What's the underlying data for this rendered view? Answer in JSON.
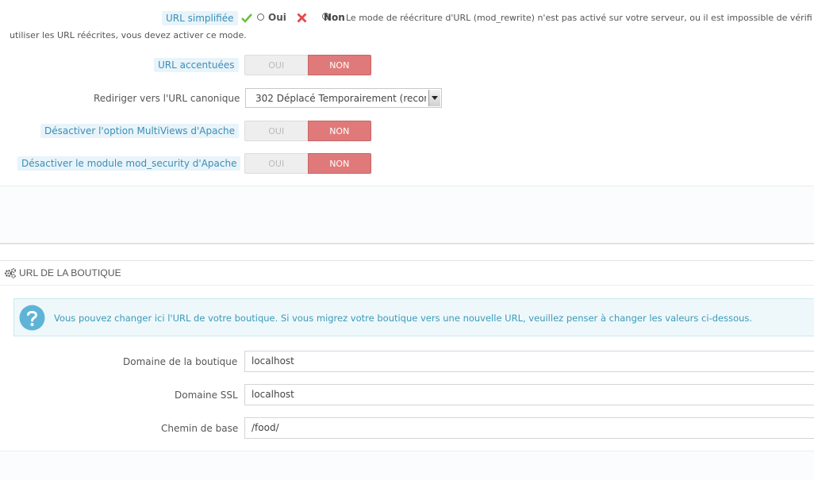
{
  "seo": {
    "simplified_url": {
      "label": "URL simplifiée",
      "oui": "Oui",
      "non": "Non",
      "note": "Le mode de réécriture d'URL (mod_rewrite) n'est pas activé sur votre serveur, ou il est impossible de vérifi",
      "note_line2": "utiliser les URL réécrites, vous devez activer ce mode."
    },
    "accented_url": {
      "label": "URL accentuées",
      "oui": "OUI",
      "non": "NON"
    },
    "canonical": {
      "label": "Rediriger vers l'URL canonique",
      "value": "302 Déplacé Temporairement (recom"
    },
    "multiviews": {
      "label": "Désactiver l'option MultiViews d'Apache",
      "oui": "OUI",
      "non": "NON"
    },
    "mod_security": {
      "label": "Désactiver le module mod_security d'Apache",
      "oui": "OUI",
      "non": "NON"
    }
  },
  "shop_url": {
    "section_title": "URL DE LA BOUTIQUE",
    "info": "Vous pouvez changer ici l'URL de votre boutique. Si vous migrez votre boutique vers une nouvelle URL, veuillez penser à changer les valeurs ci-dessous.",
    "domain": {
      "label": "Domaine de la boutique",
      "value": "localhost"
    },
    "ssl_domain": {
      "label": "Domaine SSL",
      "value": "localhost"
    },
    "base_path": {
      "label": "Chemin de base",
      "value": "/food/"
    }
  },
  "colors": {
    "accent": "#3d8db5",
    "switch_off": "#e07a7a",
    "info_bg": "#eef8fb",
    "info_icon": "#5fb4d6"
  }
}
